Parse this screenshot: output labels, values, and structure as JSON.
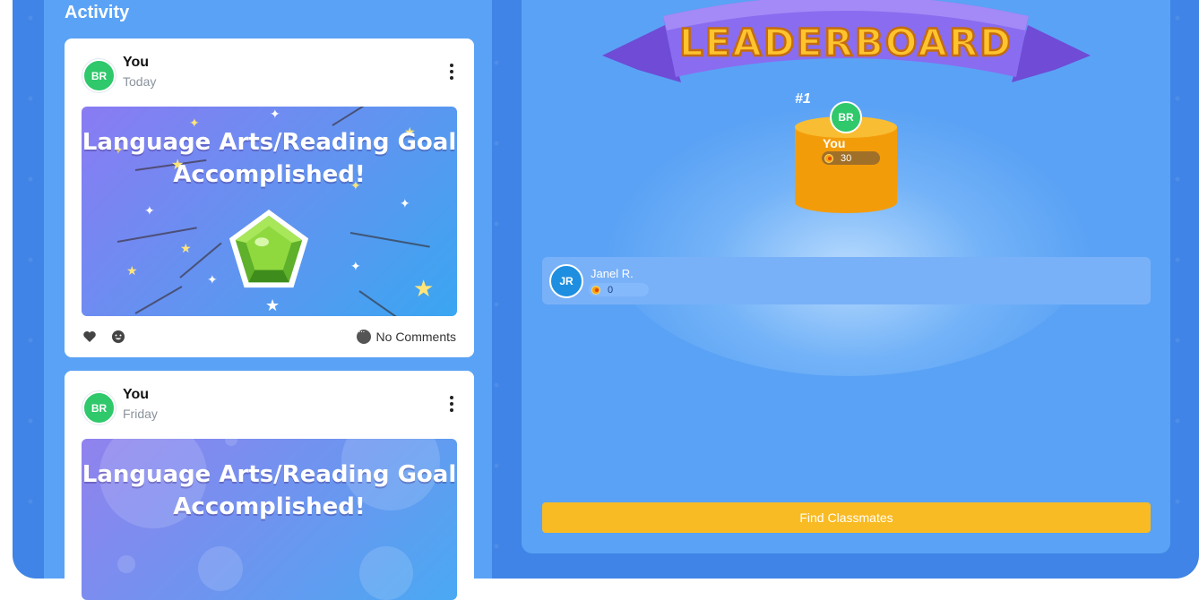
{
  "activity": {
    "title": "Activity",
    "posts": [
      {
        "avatar_initials": "BR",
        "user": "You",
        "time": "Today",
        "image_text_line1": "Language Arts/Reading Goal",
        "image_text_line2": "Accomplished!",
        "comments_label": "No Comments"
      },
      {
        "avatar_initials": "BR",
        "user": "You",
        "time": "Friday",
        "image_text_line1": "Language Arts/Reading Goal",
        "image_text_line2": "Accomplished!"
      }
    ]
  },
  "leaderboard": {
    "banner_text": "LEADERBOARD",
    "first_place": {
      "rank": "#1",
      "avatar_initials": "BR",
      "name": "You",
      "points": "30"
    },
    "others": [
      {
        "avatar_initials": "JR",
        "name": "Janel R.",
        "points": "0"
      }
    ],
    "find_button": "Find Classmates"
  },
  "colors": {
    "background": "#3f84e6",
    "panel": "#5aa2f5",
    "avatar_green": "#2fc86b",
    "avatar_blue": "#1e8fe0",
    "podium": "#f39c0a",
    "button": "#f8bb24",
    "banner": "#7e5ce8"
  },
  "icons": [
    "kebab-menu-icon",
    "heart-icon",
    "smiley-icon",
    "comment-icon",
    "coin-icon",
    "gem-icon"
  ]
}
